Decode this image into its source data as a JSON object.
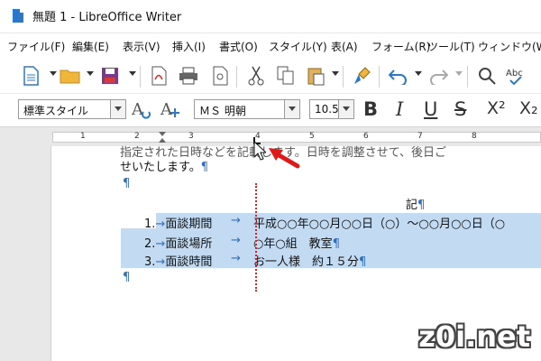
{
  "window": {
    "title": "無題 1 - LibreOffice Writer"
  },
  "menu": [
    "ファイル(F)",
    "編集(E)",
    "表示(V)",
    "挿入(I)",
    "書式(O)",
    "スタイル(Y)",
    "表(A)",
    "フォーム(R)",
    "ツール(T)",
    "ウィンドウ(W)"
  ],
  "formatting": {
    "paragraph_style": "標準スタイル",
    "font_name": "ＭＳ 明朝",
    "font_size": "10.5",
    "bold": "B",
    "italic": "I",
    "underline": "U",
    "strikethrough": "S",
    "superscript": "X²",
    "subscript": "X₂"
  },
  "toolbar_icons": [
    "new-document-icon",
    "open-folder-icon",
    "save-icon",
    "export-pdf-icon",
    "print-icon",
    "print-preview-icon",
    "cut-icon",
    "copy-icon",
    "paste-icon",
    "clone-formatting-icon",
    "undo-icon",
    "redo-icon",
    "find-replace-icon",
    "spellcheck-icon"
  ],
  "ruler": {
    "numbers": [
      "1",
      "2",
      "3",
      "4",
      "5",
      "6",
      "7",
      "8"
    ]
  },
  "document": {
    "line1": "指定された日時などを記載します。日時を調整させて、後日ご",
    "line2": "せいたします。",
    "pilcrow": "¶",
    "heading": "記",
    "items": [
      {
        "num": "1.",
        "label": "面談期間",
        "value": "平成○○年○○月○○日（○）～○○月○○日（○"
      },
      {
        "num": "2.",
        "label": "面談場所",
        "value": "○年○組　教室"
      },
      {
        "num": "3.",
        "label": "面談時間",
        "value": "お一人様　約１５分"
      }
    ],
    "tab_arrow": "→"
  },
  "watermark": "z0i.net"
}
